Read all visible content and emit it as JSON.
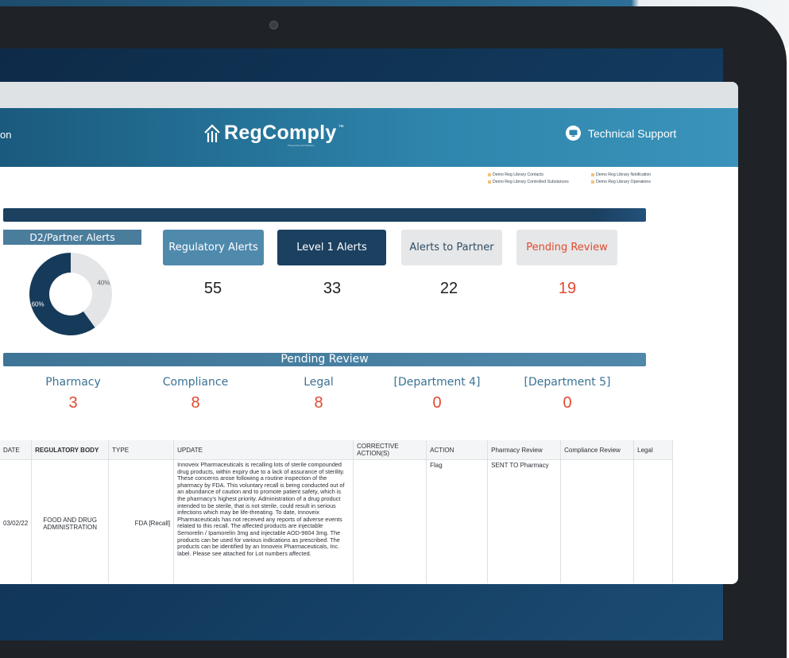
{
  "header": {
    "nav_partial": "on",
    "logo_text": "RegComply",
    "logo_tm": "™",
    "logo_sub": "Powered by D2 Solutions",
    "support_label": "Technical Support"
  },
  "legend": [
    "Demo Reg Library Contacts",
    "Demo Reg Library Controlled Substances",
    "Demo Reg Library Notification",
    "Demo Reg Library Operations"
  ],
  "d2_alerts": {
    "title": "D2/Partner Alerts",
    "chart_data": {
      "type": "pie",
      "categories": [
        "",
        ""
      ],
      "values": [
        60,
        40
      ],
      "labels": [
        "60%",
        "40%"
      ]
    }
  },
  "cards": [
    {
      "label": "Regulatory Alerts",
      "value": "55"
    },
    {
      "label": "Level 1 Alerts",
      "value": "33"
    },
    {
      "label": "Alerts to Partner",
      "value": "22"
    },
    {
      "label": "Pending Review",
      "value": "19"
    }
  ],
  "pending_review": {
    "title": "Pending Review",
    "departments": [
      {
        "label": "Pharmacy",
        "value": "3"
      },
      {
        "label": "Compliance",
        "value": "8"
      },
      {
        "label": "Legal",
        "value": "8"
      },
      {
        "label": "[Department 4]",
        "value": "0"
      },
      {
        "label": "[Department 5]",
        "value": "0"
      }
    ]
  },
  "table": {
    "columns": [
      "DATE",
      "REGULATORY BODY",
      "TYPE",
      "UPDATE",
      "CORRECTIVE ACTION(S)",
      "ACTION",
      "Pharmacy Review",
      "Compliance Review",
      "Legal"
    ],
    "row": {
      "date": "03/02/22",
      "body": "FOOD AND DRUG ADMINISTRATION",
      "type": "FDA [Recall]",
      "update": "Innoveix Pharmaceuticals is recalling lots of sterile compounded drug products, within expiry due to a lack of assurance of sterility. These concerns arose following a routine inspection of the pharmacy by FDA. This voluntary recall is being conducted out of an abundance of caution and to promote patient safety, which is the pharmacy's highest priority. Administration of a drug product intended to be sterile, that is not sterile, could result in serious infections which may be life-threating. To date, Innoveix Pharmaceuticals has not received any reports of adverse events related to this recall. The affected products are injectable Semorelin / Ipamorelin 3mg and injectable AOD-9604 3mg. The products can be used for various indications as prescribed. The products can be identified by an Innoveix Pharmaceuticals, Inc. label. Please see attached for Lot numbers affected.",
      "corrective": "",
      "action": "Flag",
      "pharmacy_review": "SENT TO Pharmacy",
      "compliance_review": "",
      "legal": ""
    }
  },
  "colors": {
    "header_blue": "#2f86ad",
    "navy": "#1b4060",
    "accent_red": "#e04a2f",
    "donut_navy": "#163a5a",
    "donut_gray": "#e3e5e7"
  }
}
